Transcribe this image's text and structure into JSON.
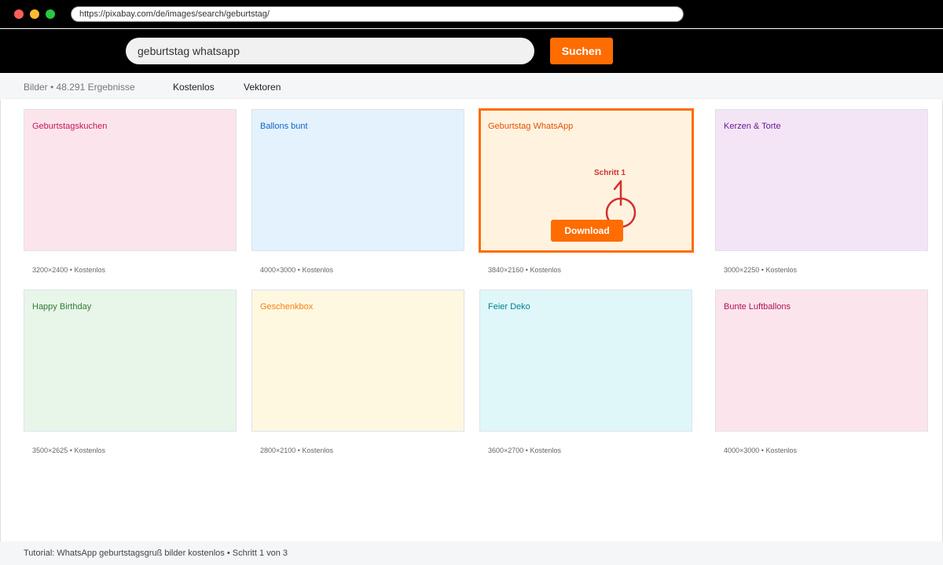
{
  "browser": {
    "url": "https://pixabay.com/de/images/search/geburtstag/"
  },
  "header": {
    "search_value": "geburtstag whatsapp",
    "search_button": "Suchen"
  },
  "subbar": {
    "results": "Bilder • 48.291 Ergebnisse",
    "filters": [
      "Kostenlos",
      "Vektoren"
    ]
  },
  "cards": [
    {
      "title": "Geburtstagskuchen",
      "meta": "3200×2400 • Kostenlos",
      "bg": "#fce4ec",
      "color": "#c2185b"
    },
    {
      "title": "Ballons bunt",
      "meta": "4000×3000 • Kostenlos",
      "bg": "#e3f2fd",
      "color": "#1565c0"
    },
    {
      "title": "Geburtstag WhatsApp",
      "meta": "3840×2160 • Kostenlos",
      "bg": "#fff3e0",
      "color": "#e65100"
    },
    {
      "title": "Kerzen & Torte",
      "meta": "3000×2250 • Kostenlos",
      "bg": "#f3e5f5",
      "color": "#6a1b9a"
    },
    {
      "title": "Happy Birthday",
      "meta": "3500×2625 • Kostenlos",
      "bg": "#e8f5e9",
      "color": "#2e7d32"
    },
    {
      "title": "Geschenkbox",
      "meta": "2800×2100 • Kostenlos",
      "bg": "#fff8e1",
      "color": "#f57f17"
    },
    {
      "title": "Feier Deko",
      "meta": "3600×2700 • Kostenlos",
      "bg": "#e0f7fa",
      "color": "#00838f"
    },
    {
      "title": "Bunte Luftballons",
      "meta": "4000×3000 • Kostenlos",
      "bg": "#fce4ec",
      "color": "#ad1457"
    }
  ],
  "highlight": {
    "download_label": "Download",
    "step_label": "Schritt 1",
    "accent": "#ff6c00",
    "annotation_color": "#d32f2f"
  },
  "footer": {
    "text": "Tutorial: WhatsApp geburtstagsgruß bilder kostenlos • Schritt 1 von 3"
  }
}
